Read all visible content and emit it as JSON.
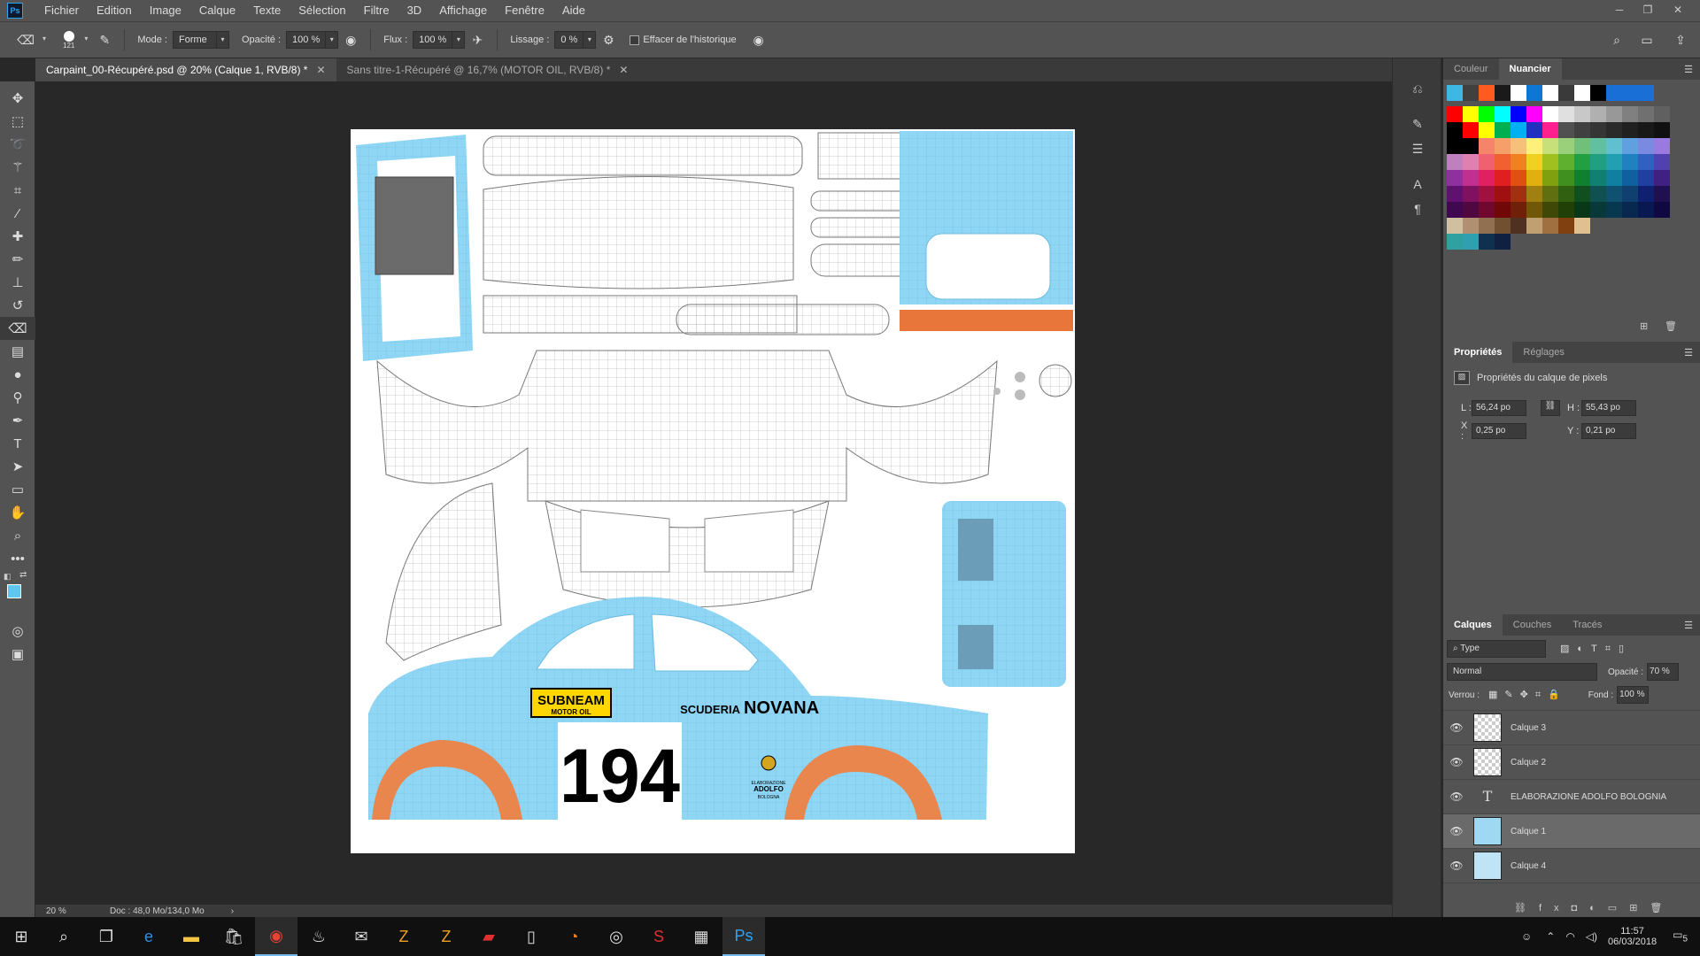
{
  "menubar": {
    "items": [
      "Fichier",
      "Edition",
      "Image",
      "Calque",
      "Texte",
      "Sélection",
      "Filtre",
      "3D",
      "Affichage",
      "Fenêtre",
      "Aide"
    ]
  },
  "options": {
    "brush_size": "121",
    "mode_label": "Mode :",
    "mode_value": "Forme",
    "opacity_label": "Opacité :",
    "opacity_value": "100 %",
    "flow_label": "Flux :",
    "flow_value": "100 %",
    "smoothing_label": "Lissage :",
    "smoothing_value": "0 %",
    "history_label": "Effacer de l'historique"
  },
  "tabs": [
    {
      "label": "Carpaint_00-Récupéré.psd @ 20% (Calque 1, RVB/8) *"
    },
    {
      "label": "Sans titre-1-Récupéré @ 16,7% (MOTOR OIL, RVB/8) *"
    }
  ],
  "document": {
    "sponsor_top": "SUBNEAM",
    "sponsor_bottom": "MOTOR OIL",
    "number": "194",
    "team_left": "SCUDERIA",
    "team_right": "NOVANA",
    "badge_line1": "ELABORAZIONE",
    "badge_line2": "ADOLFO",
    "badge_line3": "BOLOGNA"
  },
  "status": {
    "zoom": "20 %",
    "doc": "Doc : 48,0 Mo/134,0 Mo"
  },
  "swatch_panel": {
    "tab_color": "Couleur",
    "tab_swatches": "Nuancier",
    "rows": [
      [
        "#3fb7e6",
        "#404040",
        "#ff5a1f",
        "#1a1a1a",
        "#ffffff",
        "#0d77d6",
        "#ffffff",
        "#3a3a3a",
        "#ffffff",
        "#000000",
        "#1a6fd6",
        "#1a6fd6",
        "#1a6fd6"
      ],
      [
        "#ff0000",
        "#ffff00",
        "#00ff00",
        "#00ffff",
        "#0000ff",
        "#ff00ff",
        "#ffffff",
        "#e0e0e0",
        "#c8c8c8",
        "#b0b0b0",
        "#989898",
        "#808080",
        "#707070",
        "#606060"
      ],
      [
        "#000000",
        "#ff0000",
        "#ffff00",
        "#00b050",
        "#00b0f0",
        "#2030c0",
        "#ff2090",
        "#505050",
        "#404040",
        "#353535",
        "#2a2a2a",
        "#202020",
        "#181818",
        "#101010"
      ],
      [
        "#000000",
        "#000000",
        "#f5846a",
        "#f5a06a",
        "#f7c07a",
        "#fff07a",
        "#c8e07a",
        "#9ad07a",
        "#70c07a",
        "#60c0a0",
        "#60c0d0",
        "#60a0e0",
        "#7a8ae0",
        "#9a7ae0"
      ],
      [
        "#c080c0",
        "#e080b0",
        "#f06070",
        "#f06030",
        "#f08020",
        "#f0d020",
        "#a0c020",
        "#60b030",
        "#20a040",
        "#20a080",
        "#20a0b0",
        "#2080c0",
        "#3060c0",
        "#5040b0"
      ],
      [
        "#9030a0",
        "#c03090",
        "#e02060",
        "#e02020",
        "#e05010",
        "#e0b010",
        "#80a010",
        "#409020",
        "#108030",
        "#108070",
        "#1080a0",
        "#1060a0",
        "#2040a0",
        "#402080"
      ],
      [
        "#601070",
        "#801060",
        "#a01040",
        "#a01010",
        "#a03010",
        "#a08010",
        "#607010",
        "#306010",
        "#105020",
        "#105050",
        "#105070",
        "#104070",
        "#102070",
        "#201050"
      ],
      [
        "#400850",
        "#500840",
        "#700830",
        "#700808",
        "#702008",
        "#705808",
        "#404808",
        "#204008",
        "#083818",
        "#083838",
        "#083850",
        "#082850",
        "#081850",
        "#100840"
      ],
      [
        "#d0c0a0",
        "#b09070",
        "#907050",
        "#705030",
        "#503020",
        "#c0a070",
        "#a07040",
        "#804010",
        "#e0c090"
      ],
      [
        "#30a0a0",
        "#30a0b0",
        "#103050",
        "#102040"
      ]
    ]
  },
  "properties": {
    "tab_props": "Propriétés",
    "tab_adjust": "Réglages",
    "title": "Propriétés du calque de pixels",
    "w_label": "L :",
    "w_value": "56,24 po",
    "h_label": "H :",
    "h_value": "55,43 po",
    "x_label": "X :",
    "x_value": "0,25 po",
    "y_label": "Y :",
    "y_value": "0,21 po"
  },
  "layers_panel": {
    "tab_layers": "Calques",
    "tab_channels": "Couches",
    "tab_paths": "Tracés",
    "filter_type": "Type",
    "blend_mode": "Normal",
    "opacity_label": "Opacité :",
    "opacity_value": "70 %",
    "lock_label": "Verrou :",
    "fill_label": "Fond :",
    "fill_value": "100 %",
    "layers": [
      {
        "name": "Calque 3",
        "kind": "pixel"
      },
      {
        "name": "Calque 2",
        "kind": "pixel"
      },
      {
        "name": "ELABORAZIONE ADOLFO BOLOGNIA",
        "kind": "text"
      },
      {
        "name": "Calque 1",
        "kind": "pixel"
      },
      {
        "name": "Calque 4",
        "kind": "pixel"
      }
    ]
  },
  "taskbar": {
    "time": "11:57",
    "date": "06/03/2018",
    "notifications": "5"
  }
}
